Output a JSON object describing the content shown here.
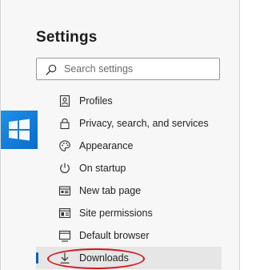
{
  "header": {
    "title": "Settings"
  },
  "search": {
    "placeholder": "Search settings"
  },
  "nav": {
    "items": [
      {
        "label": "Profiles",
        "icon": "profile-icon"
      },
      {
        "label": "Privacy, search, and services",
        "icon": "lock-icon"
      },
      {
        "label": "Appearance",
        "icon": "palette-icon"
      },
      {
        "label": "On startup",
        "icon": "power-icon"
      },
      {
        "label": "New tab page",
        "icon": "new-tab-icon"
      },
      {
        "label": "Site permissions",
        "icon": "site-permissions-icon"
      },
      {
        "label": "Default browser",
        "icon": "default-browser-icon"
      },
      {
        "label": "Downloads",
        "icon": "download-icon",
        "selected": true
      }
    ]
  },
  "colors": {
    "accent": "#0a5ec2",
    "highlight_annotation": "#d3161c",
    "windows_logo": "#1e90e8"
  }
}
